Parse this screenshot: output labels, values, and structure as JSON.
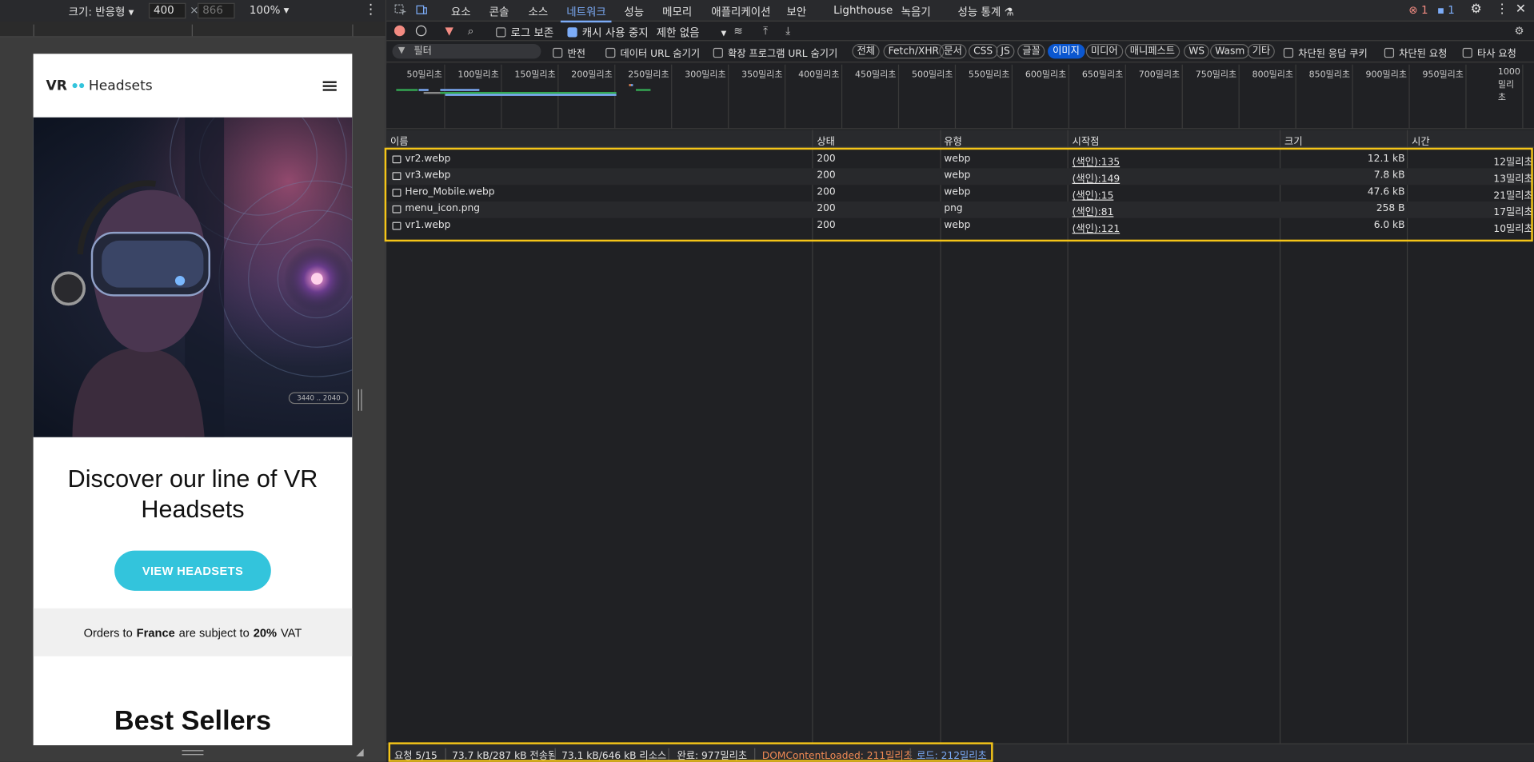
{
  "device": {
    "size_label": "크기: 반응형 ▾",
    "width": "400",
    "times": "×",
    "height": "866",
    "zoom": "100% ▾",
    "more": "⋮"
  },
  "phone": {
    "logo_vr": "VR",
    "logo_rest": "Headsets",
    "hero_res": "3440 .. 2040",
    "title": "Discover our line of VR Headsets",
    "cta": "VIEW HEADSETS",
    "vat_pre": "Orders to",
    "vat_country": "France",
    "vat_mid": "are subject to",
    "vat_rate": "20%",
    "vat_post": "VAT",
    "best": "Best Sellers"
  },
  "tabs": [
    "요소",
    "콘솔",
    "소스",
    "네트워크",
    "성능",
    "메모리",
    "애플리케이션",
    "보안",
    "Lighthouse",
    "녹음기",
    "성능 통계 ⚗"
  ],
  "badges": {
    "errors": "1",
    "messages": "1"
  },
  "toolbar": {
    "preserve_log": "로그 보존",
    "disable_cache": "캐시 사용 중지",
    "throttle": "제한 없음"
  },
  "filter": {
    "placeholder": "필터",
    "invert": "반전",
    "hide_data_urls": "데이터 URL 숨기기",
    "hide_ext_urls": "확장 프로그램 URL 숨기기",
    "types": [
      "전체",
      "Fetch/XHR",
      "문서",
      "CSS",
      "JS",
      "글꼴",
      "이미지",
      "미디어",
      "매니페스트",
      "WS",
      "Wasm",
      "기타"
    ],
    "active_type": "이미지",
    "blocked_cookies": "차단된 응답 쿠키",
    "blocked_requests": "차단된 요청",
    "third_party": "타사 요청"
  },
  "timeline_ticks": [
    "50밀리초",
    "100밀리초",
    "150밀리초",
    "200밀리초",
    "250밀리초",
    "300밀리초",
    "350밀리초",
    "400밀리초",
    "450밀리초",
    "500밀리초",
    "550밀리초",
    "600밀리초",
    "650밀리초",
    "700밀리초",
    "750밀리초",
    "800밀리초",
    "850밀리초",
    "900밀리초",
    "950밀리초",
    "1000밀리초"
  ],
  "columns": {
    "name": "이름",
    "status": "상태",
    "type": "유형",
    "initiator": "시작점",
    "size": "크기",
    "time": "시간"
  },
  "requests": [
    {
      "name": "vr2.webp",
      "status": "200",
      "type": "webp",
      "initiator": "(색인):135",
      "size": "12.1 kB",
      "time": "12밀리초"
    },
    {
      "name": "vr3.webp",
      "status": "200",
      "type": "webp",
      "initiator": "(색인):149",
      "size": "7.8 kB",
      "time": "13밀리초"
    },
    {
      "name": "Hero_Mobile.webp",
      "status": "200",
      "type": "webp",
      "initiator": "(색인):15",
      "size": "47.6 kB",
      "time": "21밀리초"
    },
    {
      "name": "menu_icon.png",
      "status": "200",
      "type": "png",
      "initiator": "(색인):81",
      "size": "258 B",
      "time": "17밀리초"
    },
    {
      "name": "vr1.webp",
      "status": "200",
      "type": "webp",
      "initiator": "(색인):121",
      "size": "6.0 kB",
      "time": "10밀리초"
    }
  ],
  "status": {
    "requests": "요청 5/15",
    "transferred": "73.7 kB/287 kB 전송됨",
    "resources": "73.1 kB/646 kB 리소스",
    "finish": "완료: 977밀리초",
    "dcl": "DOMContentLoaded: 211밀리초",
    "load": "로드: 212밀리초"
  },
  "colors": {
    "accent": "#33c4dc",
    "highlight": "#f5c518",
    "dcl": "#f28b54",
    "load": "#7cacf8",
    "active_tab": "#7cacf8"
  }
}
